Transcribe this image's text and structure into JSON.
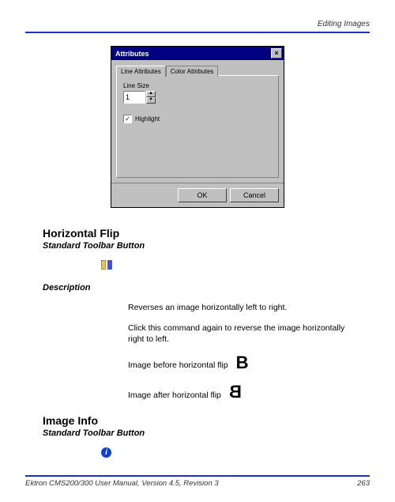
{
  "header": {
    "section": "Editing Images"
  },
  "dialog": {
    "title": "Attributes",
    "tabs": {
      "line": "Line Attributes",
      "color": "Color Attributes"
    },
    "line_size_label": "Line Size",
    "line_size_value": "1",
    "highlight_label": "Highlight",
    "ok": "OK",
    "cancel": "Cancel"
  },
  "sections": {
    "hflip": {
      "title": "Horizontal Flip",
      "sub": "Standard Toolbar Button",
      "desc_label": "Description",
      "desc1": "Reverses an image horizontally left to right.",
      "desc2": "Click this command again to reverse the image horizontally right to left.",
      "before_label": "Image before horizontal flip",
      "after_label": "Image after horizontal flip",
      "letter_before": "B",
      "letter_after": "B"
    },
    "imginfo": {
      "title": "Image Info",
      "sub": "Standard Toolbar Button"
    }
  },
  "footer": {
    "left": "Ektron CMS200/300 User Manual, Version 4.5, Revision 3",
    "page": "263"
  }
}
